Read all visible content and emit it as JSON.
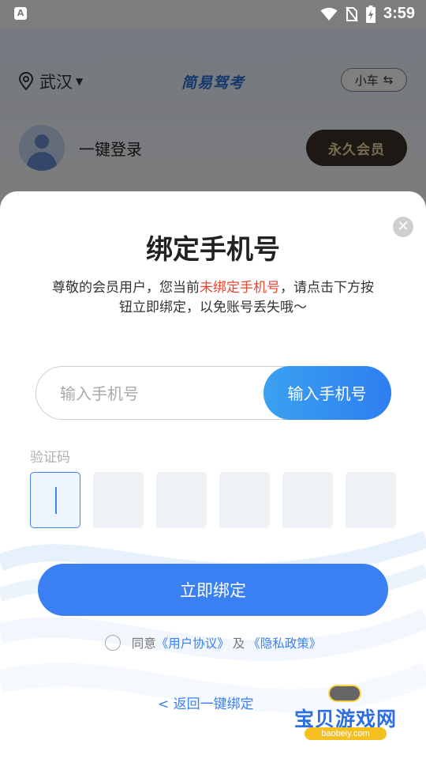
{
  "status_bar": {
    "notif_letter": "A",
    "time": "3:59",
    "icons": [
      "wifi-icon",
      "no-sim-icon",
      "battery-charging-icon"
    ]
  },
  "background_app": {
    "location": "武汉",
    "brand": "简易驾考",
    "car_type": "小车",
    "login_text": "一键登录",
    "vip_label": "永久会员"
  },
  "modal": {
    "title": "绑定手机号",
    "desc_part1": "尊敬的会员用户，您当前",
    "desc_warn": "未绑定手机号",
    "desc_part2": "，请点击下方按钮立即绑定，以免账号丢失哦～",
    "phone_placeholder": "输入手机号",
    "phone_value": "",
    "phone_button": "输入手机号",
    "code_label": "验证码",
    "code_boxes": [
      "",
      "",
      "",
      "",
      "",
      ""
    ],
    "bind_button": "立即绑定",
    "agree_prefix": "同意",
    "user_agreement": "《用户协议》",
    "agree_and": "及",
    "privacy_policy": "《隐私政策》",
    "back_link": "< 返回一键绑定"
  },
  "watermark": {
    "title": "宝贝游戏网",
    "url": "baobeiy.com"
  },
  "colors": {
    "accent": "#3b80f3",
    "warn": "#e8452e",
    "vip_text": "#f3d9a4"
  }
}
